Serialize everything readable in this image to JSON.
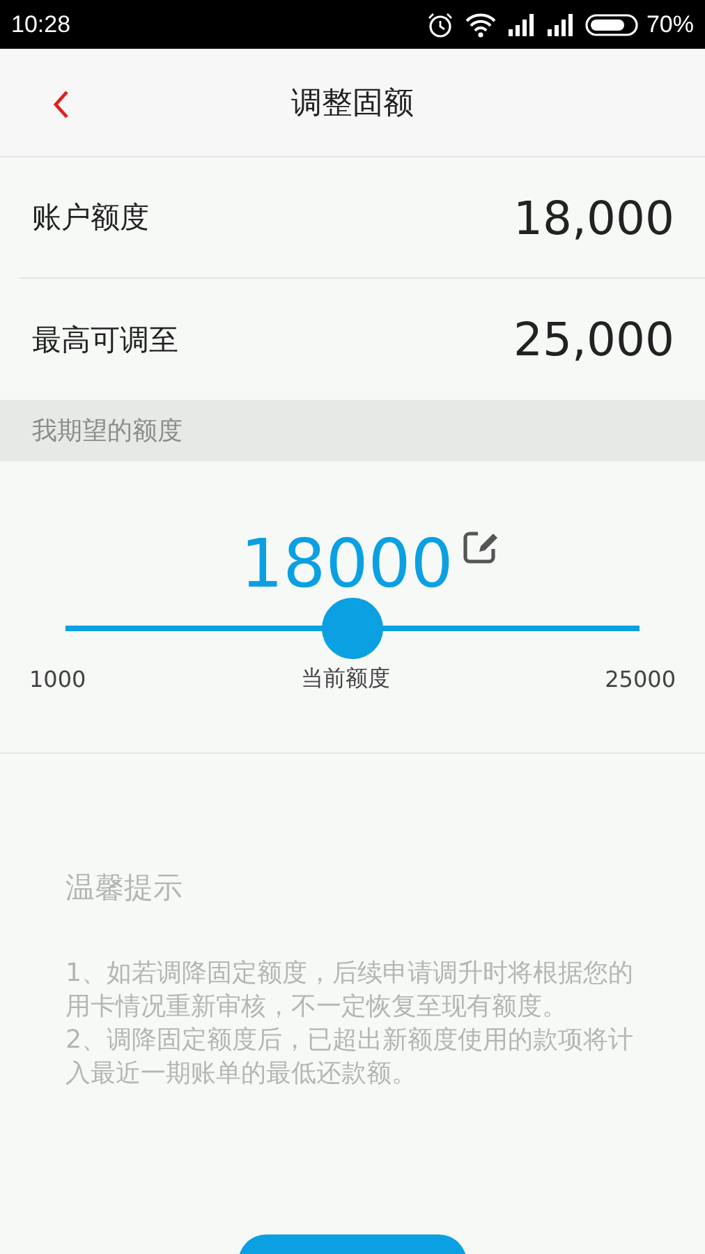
{
  "status_bar": {
    "time": "10:28",
    "battery": "70%"
  },
  "header": {
    "title": "调整固额"
  },
  "rows": [
    {
      "label": "账户额度",
      "value": "18,000"
    },
    {
      "label": "最高可调至",
      "value": "25,000"
    }
  ],
  "section": {
    "title": "我期望的额度"
  },
  "slider": {
    "amount": "18000",
    "level": 0.5,
    "min": "1000",
    "caption": "当前额度",
    "max": "25000"
  },
  "tips": {
    "title": "温馨提示",
    "paragraphs": [
      "1、如若调降固定额度，后续申请调升时将根据您的用卡情况重新审核，不一定恢复至现有额度。",
      "2、调降固定额度后，已超出新额度使用的款项将计入最近一期账单的最低还款额。"
    ]
  },
  "submit": {
    "kind": "button"
  }
}
